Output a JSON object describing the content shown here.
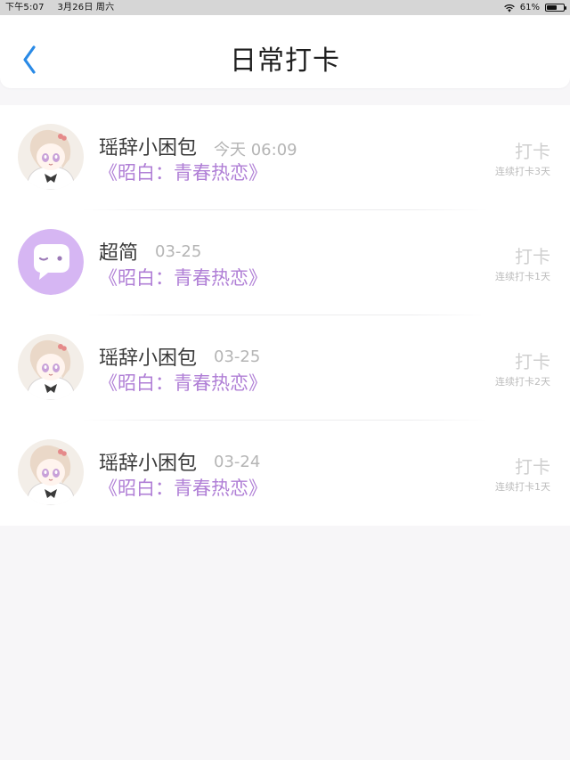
{
  "status_bar": {
    "time": "下午5:07",
    "date": "3月26日 周六",
    "battery": "61%",
    "battery_level": 0.61,
    "wifi_icon": "wifi-icon",
    "battery_icon": "battery-icon"
  },
  "header": {
    "title": "日常打卡",
    "back_icon": "chevron-left-icon",
    "accent": "#2a8ae6"
  },
  "items": [
    {
      "user": "瑶辞小困包",
      "time": "今天 06:09",
      "course": "《昭白：青春热恋》",
      "action": "打卡",
      "streak": "连续打卡3天",
      "avatar": "anime-girl-avatar"
    },
    {
      "user": "超简",
      "time": "03-25",
      "course": "《昭白：青春热恋》",
      "action": "打卡",
      "streak": "连续打卡1天",
      "avatar": "chat-bubble-avatar"
    },
    {
      "user": "瑶辞小困包",
      "time": "03-25",
      "course": "《昭白：青春热恋》",
      "action": "打卡",
      "streak": "连续打卡2天",
      "avatar": "anime-girl-avatar"
    },
    {
      "user": "瑶辞小困包",
      "time": "03-24",
      "course": "《昭白：青春热恋》",
      "action": "打卡",
      "streak": "连续打卡1天",
      "avatar": "anime-girl-avatar"
    }
  ],
  "colors": {
    "course_link": "#b07fd6",
    "muted_text": "#b5b5b5",
    "bubble_avatar_bg": "#d6b6f3"
  }
}
